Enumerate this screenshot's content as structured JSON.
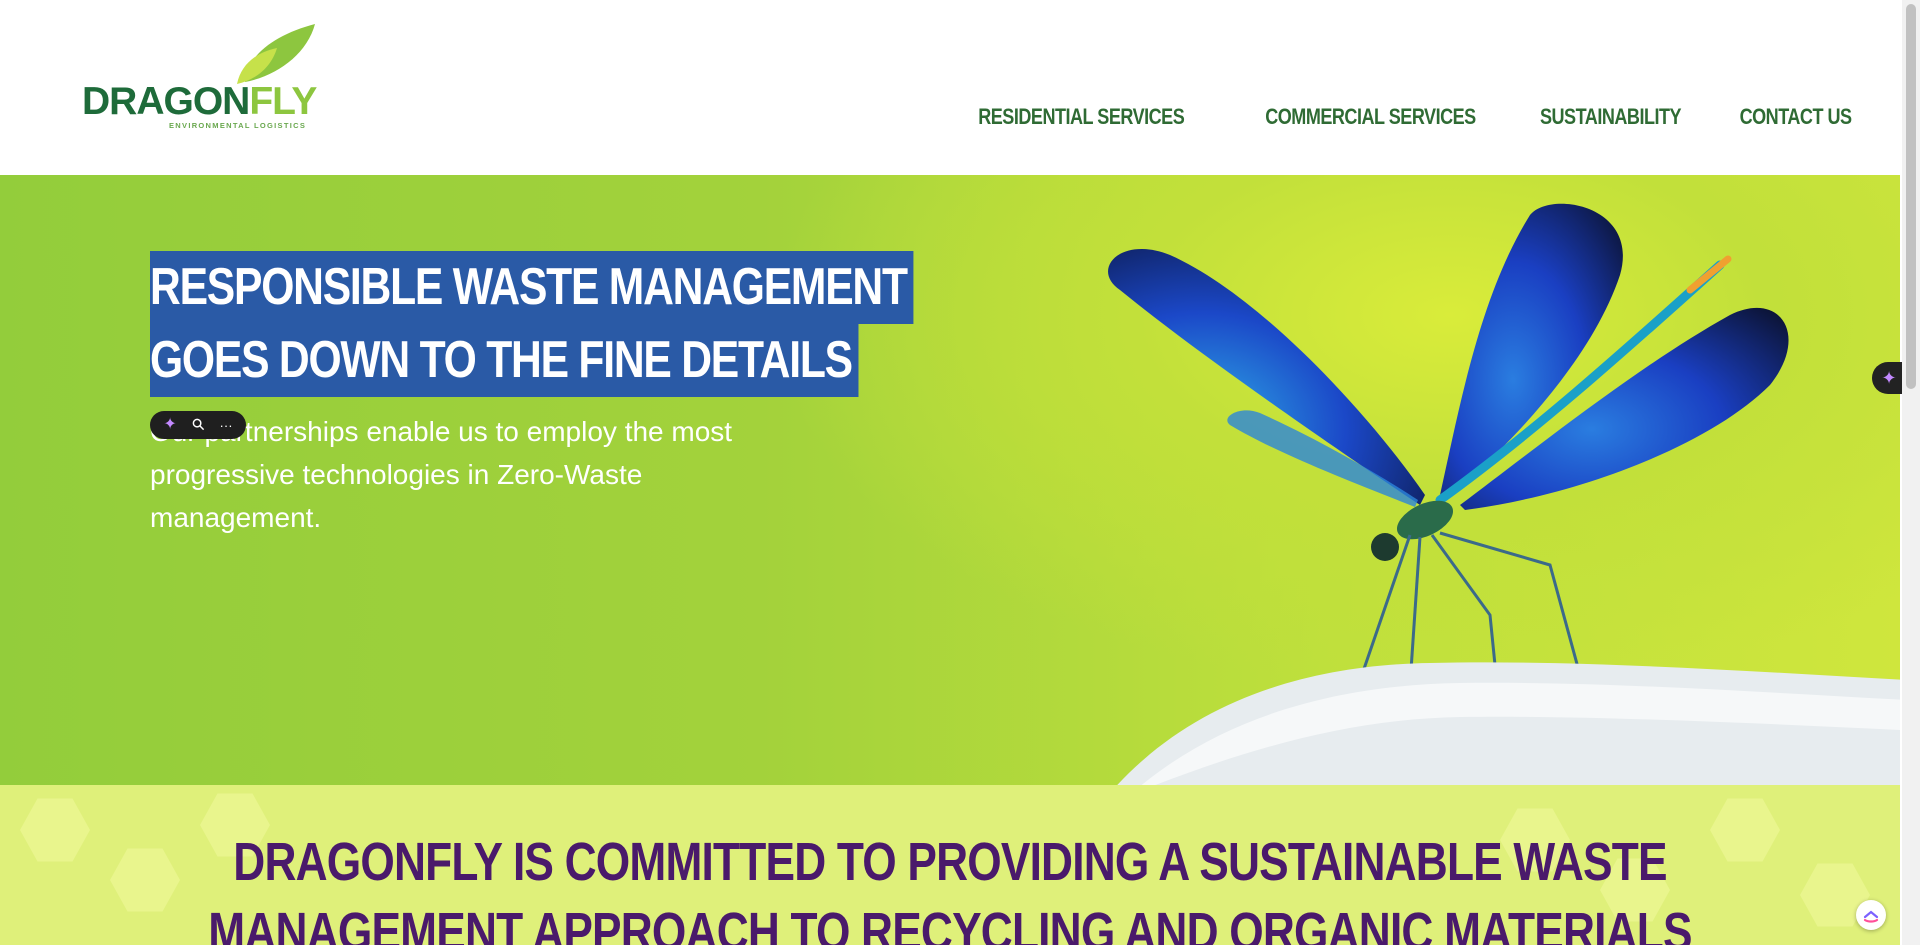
{
  "logo": {
    "brand_part1": "DRAGON",
    "brand_part2": "FLY",
    "tagline": "ENVIRONMENTAL LOGISTICS"
  },
  "nav": {
    "items": [
      {
        "label": "RESIDENTIAL SERVICES"
      },
      {
        "label": "COMMERCIAL SERVICES"
      },
      {
        "label": "SUSTAINABILITY"
      },
      {
        "label": "CONTACT US"
      }
    ]
  },
  "hero": {
    "title_line1": "RESPONSIBLE WASTE MANAGEMENT",
    "title_line2": "GOES DOWN TO THE FINE DETAILS",
    "subtitle": "Our partnerships enable us to employ the most progressive technologies in Zero-Waste management."
  },
  "selection_toolbar": {
    "spark_icon": "✦",
    "search_icon": "🔍",
    "more_icon": "···"
  },
  "mission": {
    "line1": "DRAGONFLY IS COMMITTED TO PROVIDING A SUSTAINABLE WASTE",
    "line2": "MANAGEMENT APPROACH TO RECYCLING AND ORGANIC MATERIALS"
  },
  "colors": {
    "brand_dark_green": "#1e6b3a",
    "brand_light_green": "#8dc63f",
    "nav_green": "#2f6b34",
    "selection_blue": "#2a5aa6",
    "mission_purple": "#4a1a6b"
  }
}
